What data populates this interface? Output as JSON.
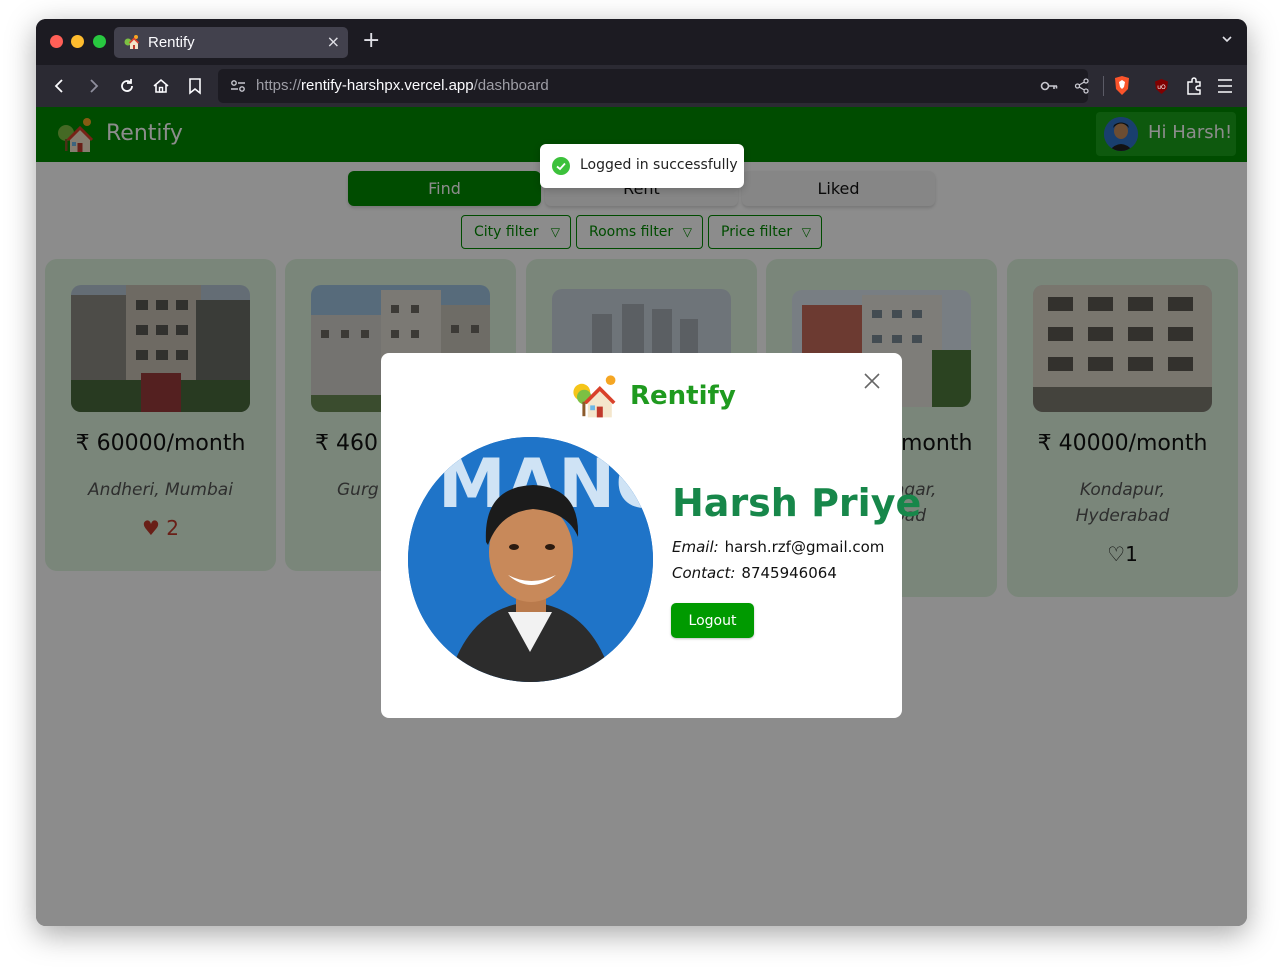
{
  "browser": {
    "tab_title": "Rentify",
    "tab_close": "×",
    "new_tab": "+",
    "url_scheme": "https://",
    "url_host": "rentify-harshpx.vercel.app",
    "url_path": "/dashboard"
  },
  "header": {
    "brand": "Rentify",
    "greeting": "Hi Harsh!"
  },
  "tabs": [
    {
      "label": "Find",
      "active": true
    },
    {
      "label": "Rent",
      "active": false
    },
    {
      "label": "Liked",
      "active": false
    }
  ],
  "filters": [
    {
      "label": "City filter"
    },
    {
      "label": "Rooms filter"
    },
    {
      "label": "Price filter"
    }
  ],
  "listings": [
    {
      "price": "₹ 60000/month",
      "location": "Andheri, Mumbai",
      "likes": "2",
      "liked": true
    },
    {
      "price": "₹ 460",
      "location": "Gurg",
      "likes": "",
      "liked": true
    },
    {
      "price": "",
      "location": "",
      "likes": "",
      "liked": false
    },
    {
      "price": "month",
      "location": "agar, bad",
      "likes": "",
      "liked": false
    },
    {
      "price": "₹ 40000/month",
      "location": "Kondapur, Hyderabad",
      "likes": "1",
      "liked": false
    }
  ],
  "toast": {
    "message": "Logged in successfully",
    "icon": "check-circle-icon"
  },
  "modal": {
    "brand": "Rentify",
    "name": "Harsh Priye",
    "email_label": "Email:",
    "email": "harsh.rzf@gmail.com",
    "contact_label": "Contact:",
    "contact": "8745946064",
    "logout_label": "Logout"
  },
  "colors": {
    "brand_green": "#008a00",
    "card_bg": "#def5de",
    "name_green": "#17874a",
    "like_red": "#c0392b"
  }
}
